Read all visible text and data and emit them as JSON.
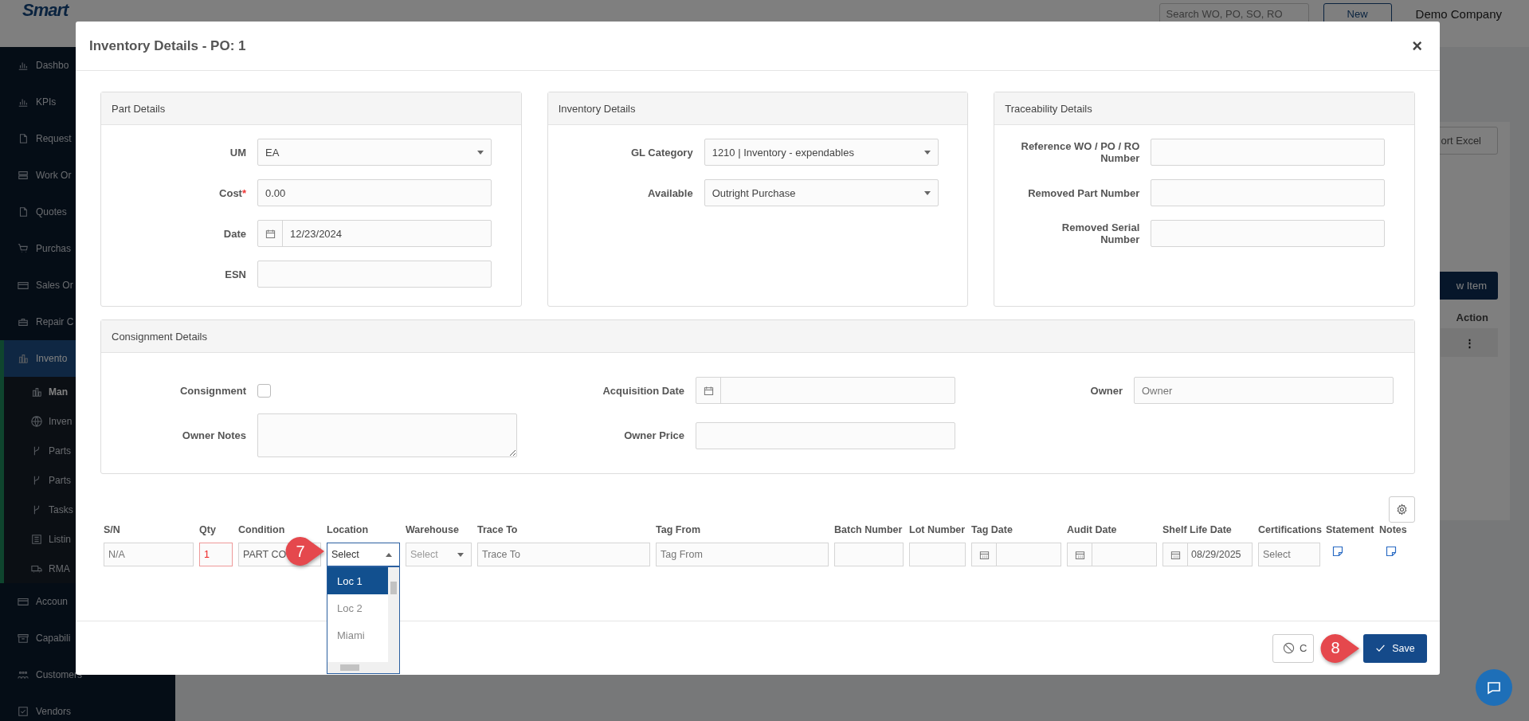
{
  "sidebar": {
    "logo": "Smart",
    "items": [
      {
        "label": "Dashbo",
        "selected": false
      },
      {
        "label": "KPIs",
        "selected": false
      },
      {
        "label": "Request",
        "selected": false
      },
      {
        "label": "Work Or",
        "selected": false
      },
      {
        "label": "Quotes",
        "selected": false
      },
      {
        "label": "Purchas",
        "selected": false
      },
      {
        "label": "Sales Or",
        "selected": false
      },
      {
        "label": "Repair C",
        "selected": false
      },
      {
        "label": "Invento",
        "selected": true,
        "children": [
          {
            "label": "Man",
            "selected": true
          },
          {
            "label": "Inven",
            "selected": false
          },
          {
            "label": "Parts",
            "selected": false
          },
          {
            "label": "Parts",
            "selected": false
          },
          {
            "label": "Tasks",
            "selected": false
          },
          {
            "label": "Listin",
            "selected": false
          },
          {
            "label": "RMA",
            "selected": false
          }
        ]
      },
      {
        "label": "Accoun",
        "selected": false
      },
      {
        "label": "Capabili",
        "selected": false
      },
      {
        "label": "Customers",
        "selected": false
      },
      {
        "label": "Vendors",
        "selected": false
      }
    ]
  },
  "header": {
    "search": {
      "placeholder": "Search WO, PO, SO, RO"
    },
    "new_button": "New",
    "company": "Demo Company"
  },
  "background": {
    "export_button": "ort Excel",
    "add_button": "w Item",
    "action_header": "Action",
    "action_menu": "⋮"
  },
  "modal": {
    "title": "Inventory Details - PO: 1",
    "close": "×",
    "sections": [
      {
        "title": "Part Details",
        "fields": [
          {
            "label": "UM",
            "kind": "select",
            "value": "EA"
          },
          {
            "label": "Cost",
            "kind": "text",
            "value": "0.00",
            "required_mark": "*"
          },
          {
            "label": "Date",
            "kind": "date",
            "value": "12/23/2024"
          },
          {
            "label": "ESN",
            "kind": "text"
          }
        ]
      },
      {
        "title": "Inventory Details",
        "fields": [
          {
            "label": "GL Category",
            "kind": "select",
            "value": "1210 | Inventory - expendables"
          },
          {
            "label": "Available",
            "kind": "select",
            "value": "Outright Purchase"
          }
        ]
      },
      {
        "title": "Traceability Details",
        "fields": [
          {
            "label": "Reference WO / PO / RO Number",
            "kind": "text"
          },
          {
            "label": "Removed Part Number",
            "kind": "text"
          },
          {
            "label": "Removed Serial Number",
            "kind": "text"
          }
        ]
      }
    ],
    "consignment": {
      "title": "Consignment Details",
      "fields": [
        {
          "label": "Consignment",
          "kind": "checkbox",
          "checked": false
        },
        {
          "label": "Acquisition Date",
          "kind": "date"
        },
        {
          "label": "Owner",
          "kind": "text",
          "placeholder": "Owner"
        },
        {
          "label": "Owner Notes",
          "kind": "textarea"
        },
        {
          "label": "Owner Price",
          "kind": "text"
        }
      ]
    },
    "line_items": {
      "columns": [
        {
          "label": "S/N",
          "kind": "text",
          "placeholder": "N/A",
          "error": false
        },
        {
          "label": "Qty",
          "kind": "text",
          "value": "1",
          "error": true
        },
        {
          "label": "Condition",
          "kind": "text",
          "value": "PART CO",
          "error": false
        },
        {
          "label": "Location",
          "kind": "select",
          "value": "Select",
          "expanded": true,
          "callout": "7",
          "options": [
            {
              "label": "Loc 1",
              "selected": true
            },
            {
              "label": "Loc 2",
              "selected": false
            },
            {
              "label": "Miami",
              "selected": false
            }
          ]
        },
        {
          "label": "Warehouse",
          "kind": "select",
          "placeholder": "Select",
          "expanded": false
        },
        {
          "label": "Trace To",
          "kind": "text",
          "placeholder": "Trace To",
          "error": false
        },
        {
          "label": "Tag From",
          "kind": "text",
          "placeholder": "Tag From",
          "error": false
        },
        {
          "label": "Batch Number",
          "kind": "text",
          "error": false
        },
        {
          "label": "Lot Number",
          "kind": "text",
          "error": false
        },
        {
          "label": "Tag Date",
          "kind": "date"
        },
        {
          "label": "Audit Date",
          "kind": "date"
        },
        {
          "label": "Shelf Life Date",
          "kind": "date",
          "value": "08/29/2025"
        },
        {
          "label": "Certifications",
          "kind": "text",
          "placeholder": "Select",
          "error": false
        },
        {
          "label": "Statement",
          "kind": "note"
        },
        {
          "label": "Notes",
          "kind": "note"
        }
      ]
    },
    "footer": {
      "cancel_button": "C",
      "save_button": "Save",
      "callout": "8"
    }
  }
}
